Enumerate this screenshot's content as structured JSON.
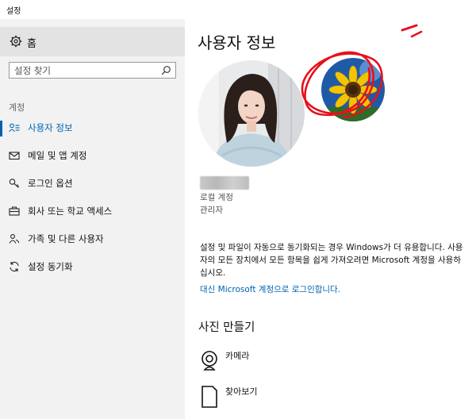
{
  "window": {
    "title": "설정"
  },
  "sidebar": {
    "home_label": "홈",
    "search_placeholder": "설정 찾기",
    "group_label": "계정",
    "items": [
      {
        "label": "사용자 정보",
        "icon": "person-list-icon",
        "active": true
      },
      {
        "label": "메일 및 앱 계정",
        "icon": "mail-icon",
        "active": false
      },
      {
        "label": "로그인 옵션",
        "icon": "key-icon",
        "active": false
      },
      {
        "label": "회사 또는 학교 액세스",
        "icon": "briefcase-icon",
        "active": false
      },
      {
        "label": "가족 및 다른 사용자",
        "icon": "people-icon",
        "active": false
      },
      {
        "label": "설정 동기화",
        "icon": "sync-icon",
        "active": false
      }
    ]
  },
  "main": {
    "title": "사용자 정보",
    "account_type": "로컬 계정",
    "account_role": "관리자",
    "description": "설정 및 파일이 자동으로 동기화되는 경우 Windows가 더 유용합니다. 사용자의 모든 장치에서 모든 항목을 쉽게 가져오려면 Microsoft 계정을 사용하십시오.",
    "signin_link": "대신 Microsoft 계정으로 로그인합니다.",
    "create_picture_title": "사진 만들기",
    "actions": [
      {
        "label": "카메라",
        "icon": "webcam-icon"
      },
      {
        "label": "찾아보기",
        "icon": "browse-file-icon"
      }
    ]
  },
  "colors": {
    "accent": "#0063b1",
    "annotation": "#e8101c",
    "sidebar_bg": "#f2f2f2"
  }
}
